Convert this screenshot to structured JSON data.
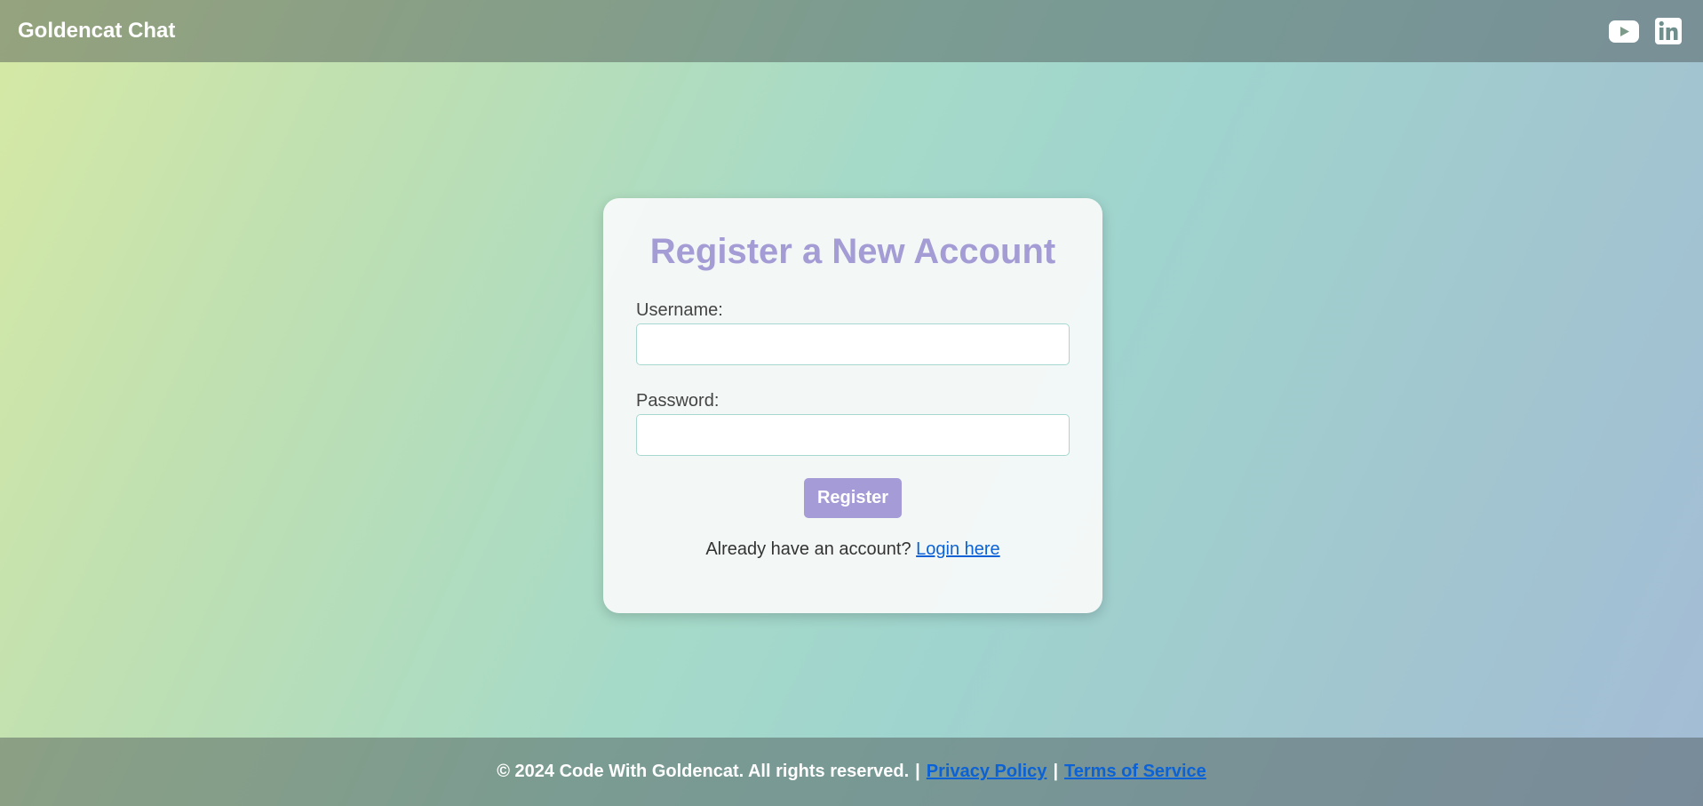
{
  "header": {
    "brand": "Goldencat Chat",
    "social": [
      {
        "icon": "youtube-icon"
      },
      {
        "icon": "linkedin-icon"
      }
    ]
  },
  "form": {
    "title": "Register a New Account",
    "username_label": "Username:",
    "username_value": "",
    "password_label": "Password:",
    "password_value": "",
    "submit_label": "Register",
    "login_prompt": "Already have an account?",
    "login_link": "Login here"
  },
  "footer": {
    "copyright": "© 2024 Code With Goldencat. All rights reserved.",
    "separator": "|",
    "privacy_link": "Privacy Policy",
    "terms_link": "Terms of Service"
  },
  "colors": {
    "accent": "#a59bd6",
    "link": "#0b62d6",
    "bar": "#6f8a80"
  }
}
